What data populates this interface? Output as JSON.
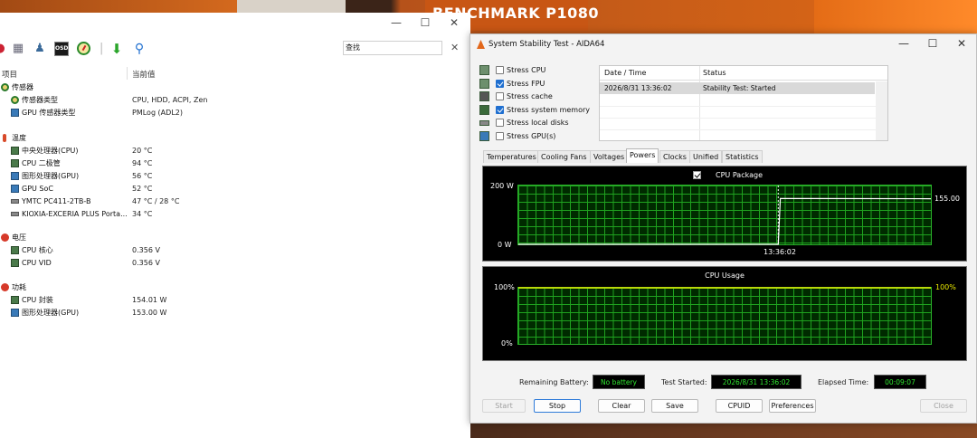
{
  "background": {
    "bench_text": "BENCHMARK P1080"
  },
  "sensor_window": {
    "search_placeholder": "查找",
    "columns": {
      "item": "项目",
      "value": "当前值"
    },
    "groups": [
      {
        "title": "传感器",
        "items": [
          {
            "label": "传感器类型",
            "value": "CPU, HDD, ACPI, Zen"
          },
          {
            "label": "GPU 传感器类型",
            "value": "PMLog  (ADL2)"
          }
        ]
      },
      {
        "title": "温度",
        "items": [
          {
            "label": "中央处理器(CPU)",
            "value": "20 °C"
          },
          {
            "label": "CPU 二极管",
            "value": "94 °C"
          },
          {
            "label": "图形处理器(GPU)",
            "value": "56 °C"
          },
          {
            "label": "GPU SoC",
            "value": "52 °C"
          },
          {
            "label": "YMTC PC411-2TB-B",
            "value": "47 °C / 28 °C"
          },
          {
            "label": "KIOXIA-EXCERIA PLUS Porta...",
            "value": "34 °C"
          }
        ]
      },
      {
        "title": "电压",
        "items": [
          {
            "label": "CPU 核心",
            "value": "0.356 V"
          },
          {
            "label": "CPU VID",
            "value": "0.356 V"
          }
        ]
      },
      {
        "title": "功耗",
        "items": [
          {
            "label": "CPU 封装",
            "value": "154.01 W"
          },
          {
            "label": "图形处理器(GPU)",
            "value": "153.00 W"
          }
        ]
      }
    ]
  },
  "stability_window": {
    "title": "System Stability Test - AIDA64",
    "stress_options": [
      {
        "label": "Stress CPU",
        "checked": false
      },
      {
        "label": "Stress FPU",
        "checked": true
      },
      {
        "label": "Stress cache",
        "checked": false
      },
      {
        "label": "Stress system memory",
        "checked": true
      },
      {
        "label": "Stress local disks",
        "checked": false
      },
      {
        "label": "Stress GPU(s)",
        "checked": false
      }
    ],
    "log_table": {
      "headers": {
        "date_time": "Date / Time",
        "status": "Status"
      },
      "rows": [
        {
          "date_time": "2026/8/31 13:36:02",
          "status": "Stability Test: Started"
        }
      ]
    },
    "tabs": [
      {
        "label": "Temperatures",
        "active": false
      },
      {
        "label": "Cooling Fans",
        "active": false
      },
      {
        "label": "Voltages",
        "active": false
      },
      {
        "label": "Powers",
        "active": true
      },
      {
        "label": "Clocks",
        "active": false
      },
      {
        "label": "Unified",
        "active": false
      },
      {
        "label": "Statistics",
        "active": false
      }
    ],
    "power_graph": {
      "legend": "CPU Package",
      "y_max_label": "200 W",
      "y_min_label": "0 W",
      "x_label": "13:36:02",
      "current_value": "155.00",
      "color": "#ffffff"
    },
    "usage_graph": {
      "title": "CPU Usage",
      "y_max_label": "100%",
      "y_min_label": "0%",
      "current_value": "100%",
      "color": "#e8e800"
    },
    "info": {
      "remaining_battery_label": "Remaining Battery:",
      "remaining_battery_value": "No battery",
      "test_started_label": "Test Started:",
      "test_started_value": "2026/8/31 13:36:02",
      "elapsed_label": "Elapsed Time:",
      "elapsed_value": "00:09:07"
    },
    "buttons": {
      "start": "Start",
      "stop": "Stop",
      "clear": "Clear",
      "save": "Save",
      "cpuid": "CPUID",
      "preferences": "Preferences",
      "close": "Close"
    }
  },
  "chart_data": [
    {
      "type": "line",
      "title": "CPU Package",
      "ylabel": "",
      "xlabel": "13:36:02",
      "ylim": [
        0,
        200
      ],
      "series": [
        {
          "name": "CPU Package",
          "x": [
            0,
            0.63,
            0.635,
            1.0
          ],
          "values": [
            0,
            0,
            156,
            155
          ]
        }
      ]
    },
    {
      "type": "line",
      "title": "CPU Usage",
      "ylim": [
        0,
        100
      ],
      "series": [
        {
          "values": [
            100,
            100
          ]
        }
      ]
    }
  ]
}
